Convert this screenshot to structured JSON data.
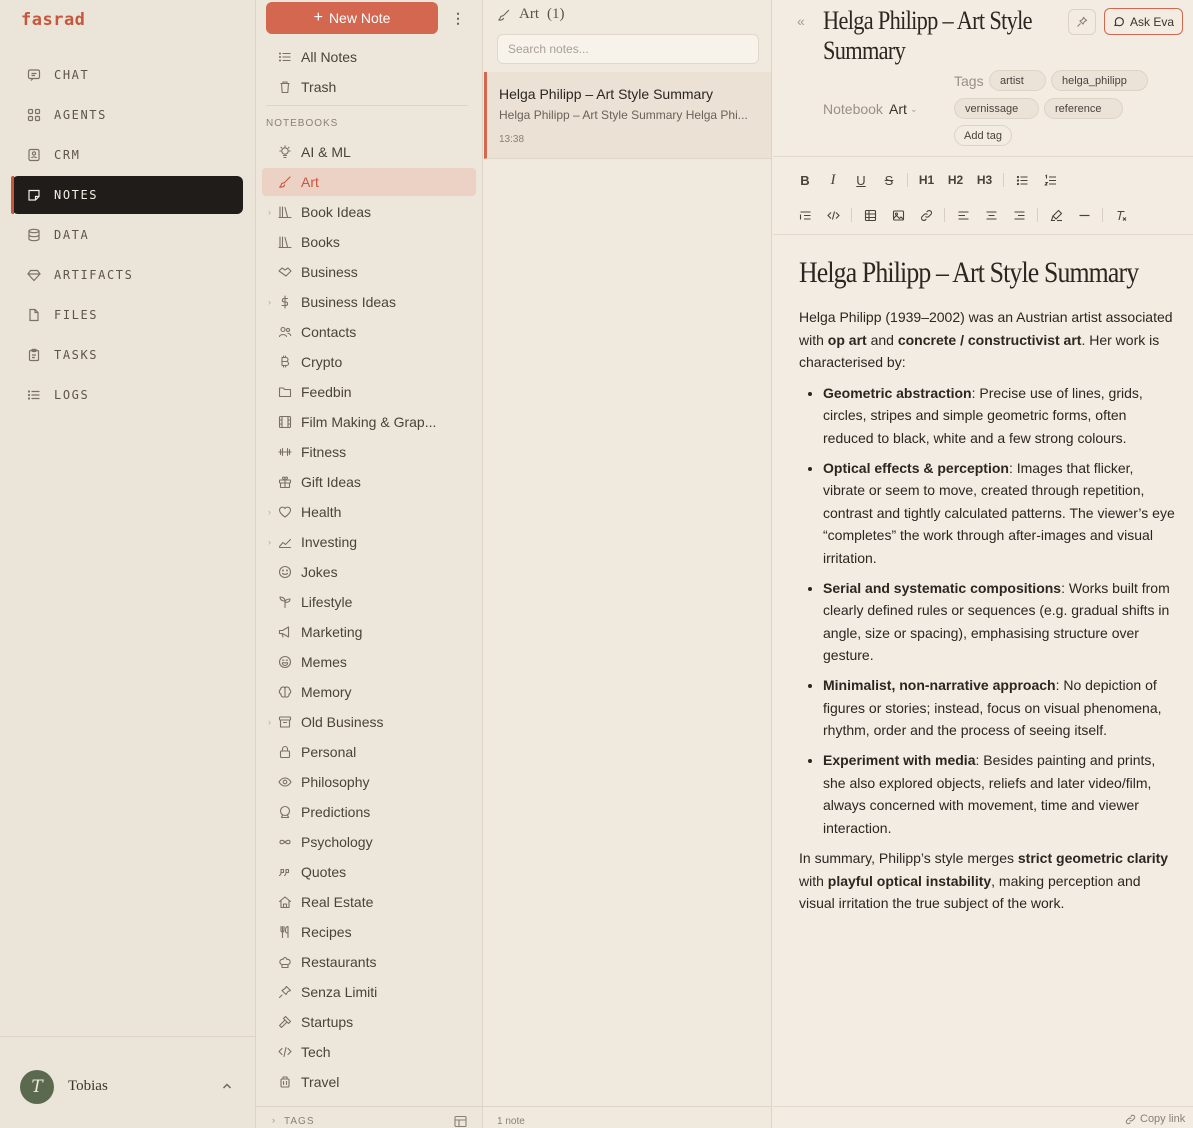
{
  "app": {
    "logo": "fasrad"
  },
  "nav": {
    "items": [
      {
        "label": "CHAT",
        "icon": "chat-icon"
      },
      {
        "label": "AGENTS",
        "icon": "grid-icon"
      },
      {
        "label": "CRM",
        "icon": "contact-card-icon"
      },
      {
        "label": "NOTES",
        "icon": "note-icon",
        "active": true
      },
      {
        "label": "DATA",
        "icon": "database-icon"
      },
      {
        "label": "ARTIFACTS",
        "icon": "gem-icon"
      },
      {
        "label": "FILES",
        "icon": "file-icon"
      },
      {
        "label": "TASKS",
        "icon": "clipboard-icon"
      },
      {
        "label": "LOGS",
        "icon": "list-icon"
      }
    ]
  },
  "user": {
    "initial": "T",
    "name": "Tobias"
  },
  "notebooks": {
    "new_note_label": "New Note",
    "all_notes": "All Notes",
    "trash": "Trash",
    "section_label": "NOTEBOOKS",
    "items": [
      {
        "label": "AI & ML"
      },
      {
        "label": "Art",
        "active": true
      },
      {
        "label": "Book Ideas"
      },
      {
        "label": "Books"
      },
      {
        "label": "Business"
      },
      {
        "label": "Business Ideas"
      },
      {
        "label": "Contacts"
      },
      {
        "label": "Crypto"
      },
      {
        "label": "Feedbin"
      },
      {
        "label": "Film Making & Grap..."
      },
      {
        "label": "Fitness"
      },
      {
        "label": "Gift Ideas"
      },
      {
        "label": "Health"
      },
      {
        "label": "Investing"
      },
      {
        "label": "Jokes"
      },
      {
        "label": "Lifestyle"
      },
      {
        "label": "Marketing"
      },
      {
        "label": "Memes"
      },
      {
        "label": "Memory"
      },
      {
        "label": "Old Business"
      },
      {
        "label": "Personal"
      },
      {
        "label": "Philosophy"
      },
      {
        "label": "Predictions"
      },
      {
        "label": "Psychology"
      },
      {
        "label": "Quotes"
      },
      {
        "label": "Real Estate"
      },
      {
        "label": "Recipes"
      },
      {
        "label": "Restaurants"
      },
      {
        "label": "Senza Limiti"
      },
      {
        "label": "Startups"
      },
      {
        "label": "Tech"
      },
      {
        "label": "Travel"
      }
    ],
    "tags_label": "TAGS"
  },
  "notelist": {
    "header": "Art",
    "count": "(1)",
    "search_placeholder": "Search notes...",
    "notes": [
      {
        "title": "Helga Philipp – Art Style Summary",
        "preview": "Helga Philipp – Art Style Summary Helga Phi...",
        "time": "13:38"
      }
    ],
    "footer": "1 note"
  },
  "editor": {
    "title": "Helga Philipp – Art Style Summary",
    "ask_label": "Ask Eva",
    "tags_label": "Tags",
    "tags": [
      "artist",
      "helga_philipp",
      "vernissage",
      "reference"
    ],
    "add_tag_label": "Add tag",
    "notebook_label": "Notebook",
    "notebook_value": "Art",
    "toolbar": {
      "h1": "H1",
      "h2": "H2",
      "h3": "H3"
    },
    "doc": {
      "heading": "Helga Philipp – Art Style Summary",
      "intro_1": "Helga Philipp (1939–2002) was an Austrian artist associated with ",
      "intro_b1": "op art",
      "intro_2": " and ",
      "intro_b2": "concrete / constructivist art",
      "intro_3": ". Her work is characterised by:",
      "bullets": [
        {
          "bold": "Geometric abstraction",
          "text": ": Precise use of lines, grids, circles, stripes and simple geometric forms, often reduced to black, white and a few strong colours."
        },
        {
          "bold": "Optical effects & perception",
          "text": ": Images that flicker, vibrate or seem to move, created through repetition, contrast and tightly calculated patterns. The viewer’s eye “completes” the work through after-images and visual irritation."
        },
        {
          "bold": "Serial and systematic compositions",
          "text": ": Works built from clearly defined rules or sequences (e.g. gradual shifts in angle, size or spacing), emphasising structure over gesture."
        },
        {
          "bold": "Minimalist, non-narrative approach",
          "text": ": No depiction of figures or stories; instead, focus on visual phenomena, rhythm, order and the process of seeing itself."
        },
        {
          "bold": "Experiment with media",
          "text": ": Besides painting and prints, she also explored objects, reliefs and later video/film, always concerned with movement, time and viewer interaction."
        }
      ],
      "summary_1": "In summary, Philipp’s style merges ",
      "summary_b1": "strict geometric clarity",
      "summary_2": " with ",
      "summary_b2": "playful optical instability",
      "summary_3": ", making perception and visual irritation the true subject of the work."
    },
    "copy_link": "Copy link"
  }
}
